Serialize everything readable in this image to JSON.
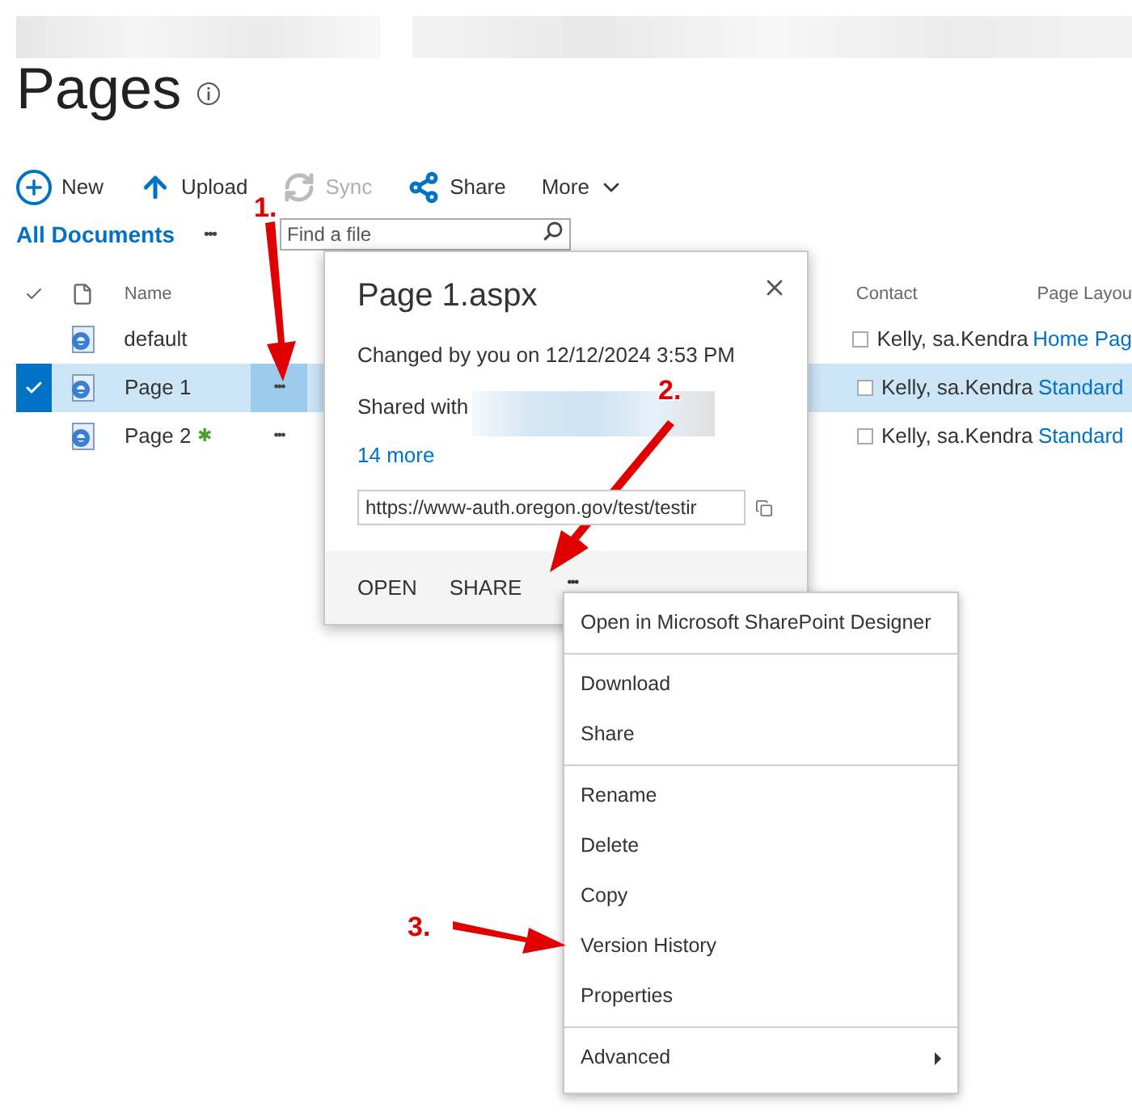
{
  "page_title": "Pages",
  "toolbar": [
    {
      "label": "New",
      "kind": "new",
      "disabled": false
    },
    {
      "label": "Upload",
      "kind": "upload",
      "disabled": false
    },
    {
      "label": "Sync",
      "kind": "sync",
      "disabled": true
    },
    {
      "label": "Share",
      "kind": "share",
      "disabled": false
    },
    {
      "label": "More",
      "kind": "more",
      "disabled": false
    }
  ],
  "view": {
    "label": "All Documents",
    "more": "•••"
  },
  "search": {
    "placeholder": "Find a file"
  },
  "table": {
    "columns": [
      "Name",
      "Contact",
      "Page Layou"
    ],
    "rows": [
      {
        "name": "default",
        "selected": false,
        "contact": "Kelly, sa.Kendra",
        "page_layout": "Home Pag"
      },
      {
        "name": "Page 1",
        "selected": true,
        "actions": "•••",
        "contact": "Kelly, sa.Kendra",
        "page_layout": "Standard"
      },
      {
        "name": "Page 2",
        "new_mark": "✱",
        "selected": false,
        "actions": "•••",
        "contact": "Kelly, sa.Kendra",
        "page_layout": "Standard"
      }
    ]
  },
  "callout": {
    "title": "Page 1.aspx",
    "changed": "Changed by you on 12/12/2024 3:53 PM",
    "shared_label": "Shared with",
    "more_link": "14 more",
    "url": "https://www-auth.oregon.gov/test/testir",
    "actions": [
      "OPEN",
      "SHARE"
    ],
    "more": "•••"
  },
  "context_menu": {
    "groups": [
      [
        {
          "label": "Open in Microsoft SharePoint Designer",
          "has_submenu": false
        }
      ],
      [
        {
          "label": "Download",
          "has_submenu": false
        },
        {
          "label": "Share",
          "has_submenu": false
        }
      ],
      [
        {
          "label": "Rename",
          "has_submenu": false
        },
        {
          "label": "Delete",
          "has_submenu": false
        },
        {
          "label": "Copy",
          "has_submenu": false
        },
        {
          "label": "Version History",
          "has_submenu": false
        },
        {
          "label": "Properties",
          "has_submenu": false
        }
      ],
      [
        {
          "label": "Advanced",
          "has_submenu": true
        }
      ]
    ]
  },
  "annotations": [
    "1.",
    "2.",
    "3."
  ]
}
